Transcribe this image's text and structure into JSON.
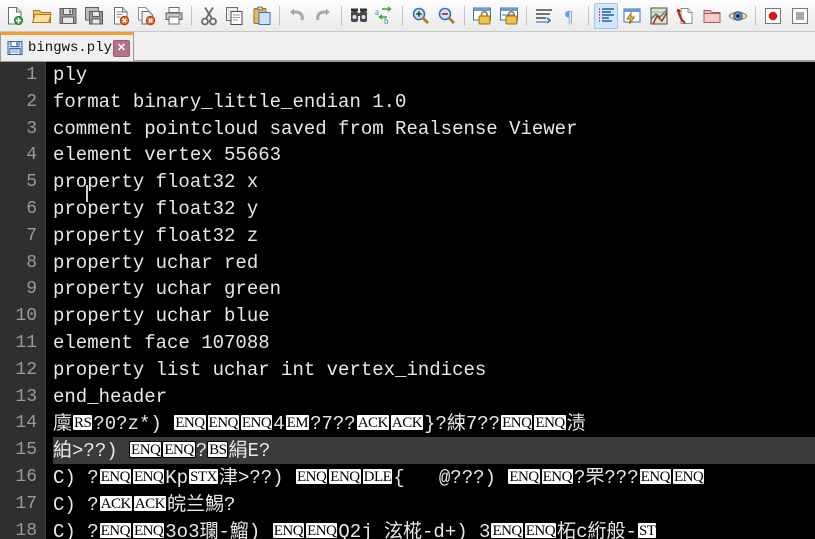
{
  "window": {
    "app": "Notepad++",
    "accent_tab_active": "#ef9f34",
    "editor_bg": "#000000",
    "gutter_bg": "#2f2f2f",
    "text_color": "#e8e8e8",
    "current_line_bg": "#3b3b3b"
  },
  "toolbar": {
    "groups": [
      {
        "buttons": [
          {
            "name": "new-file-icon",
            "tooltip": "New"
          },
          {
            "name": "open-file-icon",
            "tooltip": "Open"
          },
          {
            "name": "save-icon",
            "tooltip": "Save"
          },
          {
            "name": "save-all-icon",
            "tooltip": "Save All"
          },
          {
            "name": "close-file-icon",
            "tooltip": "Close"
          },
          {
            "name": "close-all-icon",
            "tooltip": "Close All"
          },
          {
            "name": "print-icon",
            "tooltip": "Print"
          }
        ]
      },
      {
        "buttons": [
          {
            "name": "cut-icon",
            "tooltip": "Cut"
          },
          {
            "name": "copy-icon",
            "tooltip": "Copy"
          },
          {
            "name": "paste-icon",
            "tooltip": "Paste"
          }
        ]
      },
      {
        "buttons": [
          {
            "name": "undo-icon",
            "tooltip": "Undo"
          },
          {
            "name": "redo-icon",
            "tooltip": "Redo"
          }
        ]
      },
      {
        "buttons": [
          {
            "name": "find-icon",
            "tooltip": "Find"
          },
          {
            "name": "replace-icon",
            "tooltip": "Replace"
          }
        ]
      },
      {
        "buttons": [
          {
            "name": "zoom-in-icon",
            "tooltip": "Zoom In"
          },
          {
            "name": "zoom-out-icon",
            "tooltip": "Zoom Out"
          }
        ]
      },
      {
        "buttons": [
          {
            "name": "sync-vertical-scroll-icon",
            "tooltip": "Synchronize Vertical Scrolling"
          },
          {
            "name": "sync-horizontal-scroll-icon",
            "tooltip": "Synchronize Horizontal Scrolling"
          }
        ]
      },
      {
        "buttons": [
          {
            "name": "word-wrap-icon",
            "tooltip": "Word wrap"
          },
          {
            "name": "show-all-chars-icon",
            "tooltip": "Show All Characters"
          }
        ]
      },
      {
        "buttons": [
          {
            "name": "indent-guide-icon",
            "tooltip": "Show Indent Guide",
            "selected": true
          },
          {
            "name": "user-defined-dialog-icon",
            "tooltip": "User-Defined Dialogue"
          },
          {
            "name": "document-map-icon",
            "tooltip": "Document Map"
          },
          {
            "name": "function-list-icon",
            "tooltip": "Function List"
          },
          {
            "name": "folder-workspace-icon",
            "tooltip": "Folder as Workspace"
          },
          {
            "name": "monitoring-icon",
            "tooltip": "Monitoring (tail -f)"
          }
        ]
      },
      {
        "buttons": [
          {
            "name": "macro-record-icon",
            "tooltip": "Start Recording"
          },
          {
            "name": "macro-stop-icon",
            "tooltip": "Stop Recording"
          }
        ]
      }
    ]
  },
  "tabs": [
    {
      "label": "bingws.ply",
      "icon": "saved-document-icon",
      "close_label": "✕",
      "active": true
    }
  ],
  "editor": {
    "first_line_number": 1,
    "current_line": 15,
    "lines": [
      {
        "n": "1",
        "tokens": [
          {
            "t": "txt",
            "v": "ply"
          }
        ]
      },
      {
        "n": "2",
        "tokens": [
          {
            "t": "txt",
            "v": "format binary_little_endian 1.0"
          }
        ]
      },
      {
        "n": "3",
        "tokens": [
          {
            "t": "txt",
            "v": "comment pointcloud saved from Realsense Viewer"
          }
        ]
      },
      {
        "n": "4",
        "tokens": [
          {
            "t": "txt",
            "v": "element vertex 55663"
          }
        ]
      },
      {
        "n": "5",
        "tokens": [
          {
            "t": "txt",
            "v": "property float32 x"
          }
        ]
      },
      {
        "n": "6",
        "tokens": [
          {
            "t": "txt",
            "v": "property float32 y"
          }
        ]
      },
      {
        "n": "7",
        "tokens": [
          {
            "t": "txt",
            "v": "property float32 z"
          }
        ]
      },
      {
        "n": "8",
        "tokens": [
          {
            "t": "txt",
            "v": "property uchar red"
          }
        ]
      },
      {
        "n": "9",
        "tokens": [
          {
            "t": "txt",
            "v": "property uchar green"
          }
        ]
      },
      {
        "n": "10",
        "tokens": [
          {
            "t": "txt",
            "v": "property uchar blue"
          }
        ]
      },
      {
        "n": "11",
        "tokens": [
          {
            "t": "txt",
            "v": "element face 107088"
          }
        ]
      },
      {
        "n": "12",
        "tokens": [
          {
            "t": "txt",
            "v": "property list uchar int vertex_indices"
          }
        ]
      },
      {
        "n": "13",
        "tokens": [
          {
            "t": "txt",
            "v": "end_header"
          }
        ]
      },
      {
        "n": "14",
        "tokens": [
          {
            "t": "cjk",
            "v": "廩"
          },
          {
            "t": "ctrl",
            "v": "RS"
          },
          {
            "t": "txt",
            "v": "?0?z*) "
          },
          {
            "t": "ctrl",
            "v": "ENQ"
          },
          {
            "t": "ctrl",
            "v": "ENQ"
          },
          {
            "t": "ctrl",
            "v": "ENQ"
          },
          {
            "t": "txt",
            "v": "4"
          },
          {
            "t": "ctrl",
            "v": "EM"
          },
          {
            "t": "txt",
            "v": "?7??"
          },
          {
            "t": "ctrl",
            "v": "ACK"
          },
          {
            "t": "ctrl",
            "v": "ACK"
          },
          {
            "t": "txt",
            "v": "}?"
          },
          {
            "t": "cjk",
            "v": "綀"
          },
          {
            "t": "txt",
            "v": "7??"
          },
          {
            "t": "ctrl",
            "v": "ENQ"
          },
          {
            "t": "ctrl",
            "v": "ENQ"
          },
          {
            "t": "cjk",
            "v": "渍"
          }
        ]
      },
      {
        "n": "15",
        "tokens": [
          {
            "t": "cjk",
            "v": "絈"
          },
          {
            "t": "txt",
            "v": ">??) "
          },
          {
            "t": "ctrl",
            "v": "ENQ"
          },
          {
            "t": "ctrl",
            "v": "ENQ"
          },
          {
            "t": "txt",
            "v": "?"
          },
          {
            "t": "ctrl",
            "v": "BS"
          },
          {
            "t": "cjk",
            "v": "絹"
          },
          {
            "t": "txt",
            "v": "E?"
          }
        ]
      },
      {
        "n": "16",
        "tokens": [
          {
            "t": "txt",
            "v": "C) ?"
          },
          {
            "t": "ctrl",
            "v": "ENQ"
          },
          {
            "t": "ctrl",
            "v": "ENQ"
          },
          {
            "t": "txt",
            "v": "Kp"
          },
          {
            "t": "ctrl",
            "v": "STX"
          },
          {
            "t": "cjk",
            "v": "津"
          },
          {
            "t": "txt",
            "v": ">??) "
          },
          {
            "t": "ctrl",
            "v": "ENQ"
          },
          {
            "t": "ctrl",
            "v": "ENQ"
          },
          {
            "t": "ctrl",
            "v": "DLE"
          },
          {
            "t": "txt",
            "v": "{   @???) "
          },
          {
            "t": "ctrl",
            "v": "ENQ"
          },
          {
            "t": "ctrl",
            "v": "ENQ"
          },
          {
            "t": "txt",
            "v": "?"
          },
          {
            "t": "cjk",
            "v": "罘"
          },
          {
            "t": "txt",
            "v": "???"
          },
          {
            "t": "ctrl",
            "v": "ENQ"
          },
          {
            "t": "ctrl",
            "v": "ENQ"
          }
        ]
      },
      {
        "n": "17",
        "tokens": [
          {
            "t": "txt",
            "v": "C) ?"
          },
          {
            "t": "ctrl",
            "v": "ACK"
          },
          {
            "t": "ctrl",
            "v": "ACK"
          },
          {
            "t": "cjk",
            "v": "皖兰鯣"
          },
          {
            "t": "txt",
            "v": "?"
          }
        ]
      },
      {
        "n": "18",
        "tokens": [
          {
            "t": "txt",
            "v": "C) ?"
          },
          {
            "t": "ctrl",
            "v": "ENQ"
          },
          {
            "t": "ctrl",
            "v": "ENQ"
          },
          {
            "t": "txt",
            "v": "3o3"
          },
          {
            "t": "cjk",
            "v": "瓓"
          },
          {
            "t": "txt",
            "v": "-"
          },
          {
            "t": "cjk",
            "v": "鰡"
          },
          {
            "t": "txt",
            "v": ") "
          },
          {
            "t": "ctrl",
            "v": "ENQ"
          },
          {
            "t": "ctrl",
            "v": "ENQ"
          },
          {
            "t": "txt",
            "v": "Q2j "
          },
          {
            "t": "cjk",
            "v": "泫椛"
          },
          {
            "t": "txt",
            "v": "-d+) 3"
          },
          {
            "t": "ctrl",
            "v": "ENQ"
          },
          {
            "t": "ctrl",
            "v": "ENQ"
          },
          {
            "t": "cjk",
            "v": "柘"
          },
          {
            "t": "txt",
            "v": "c"
          },
          {
            "t": "cjk",
            "v": "絎般"
          },
          {
            "t": "txt",
            "v": "-"
          },
          {
            "t": "ctrl",
            "v": "ST"
          }
        ]
      }
    ]
  }
}
